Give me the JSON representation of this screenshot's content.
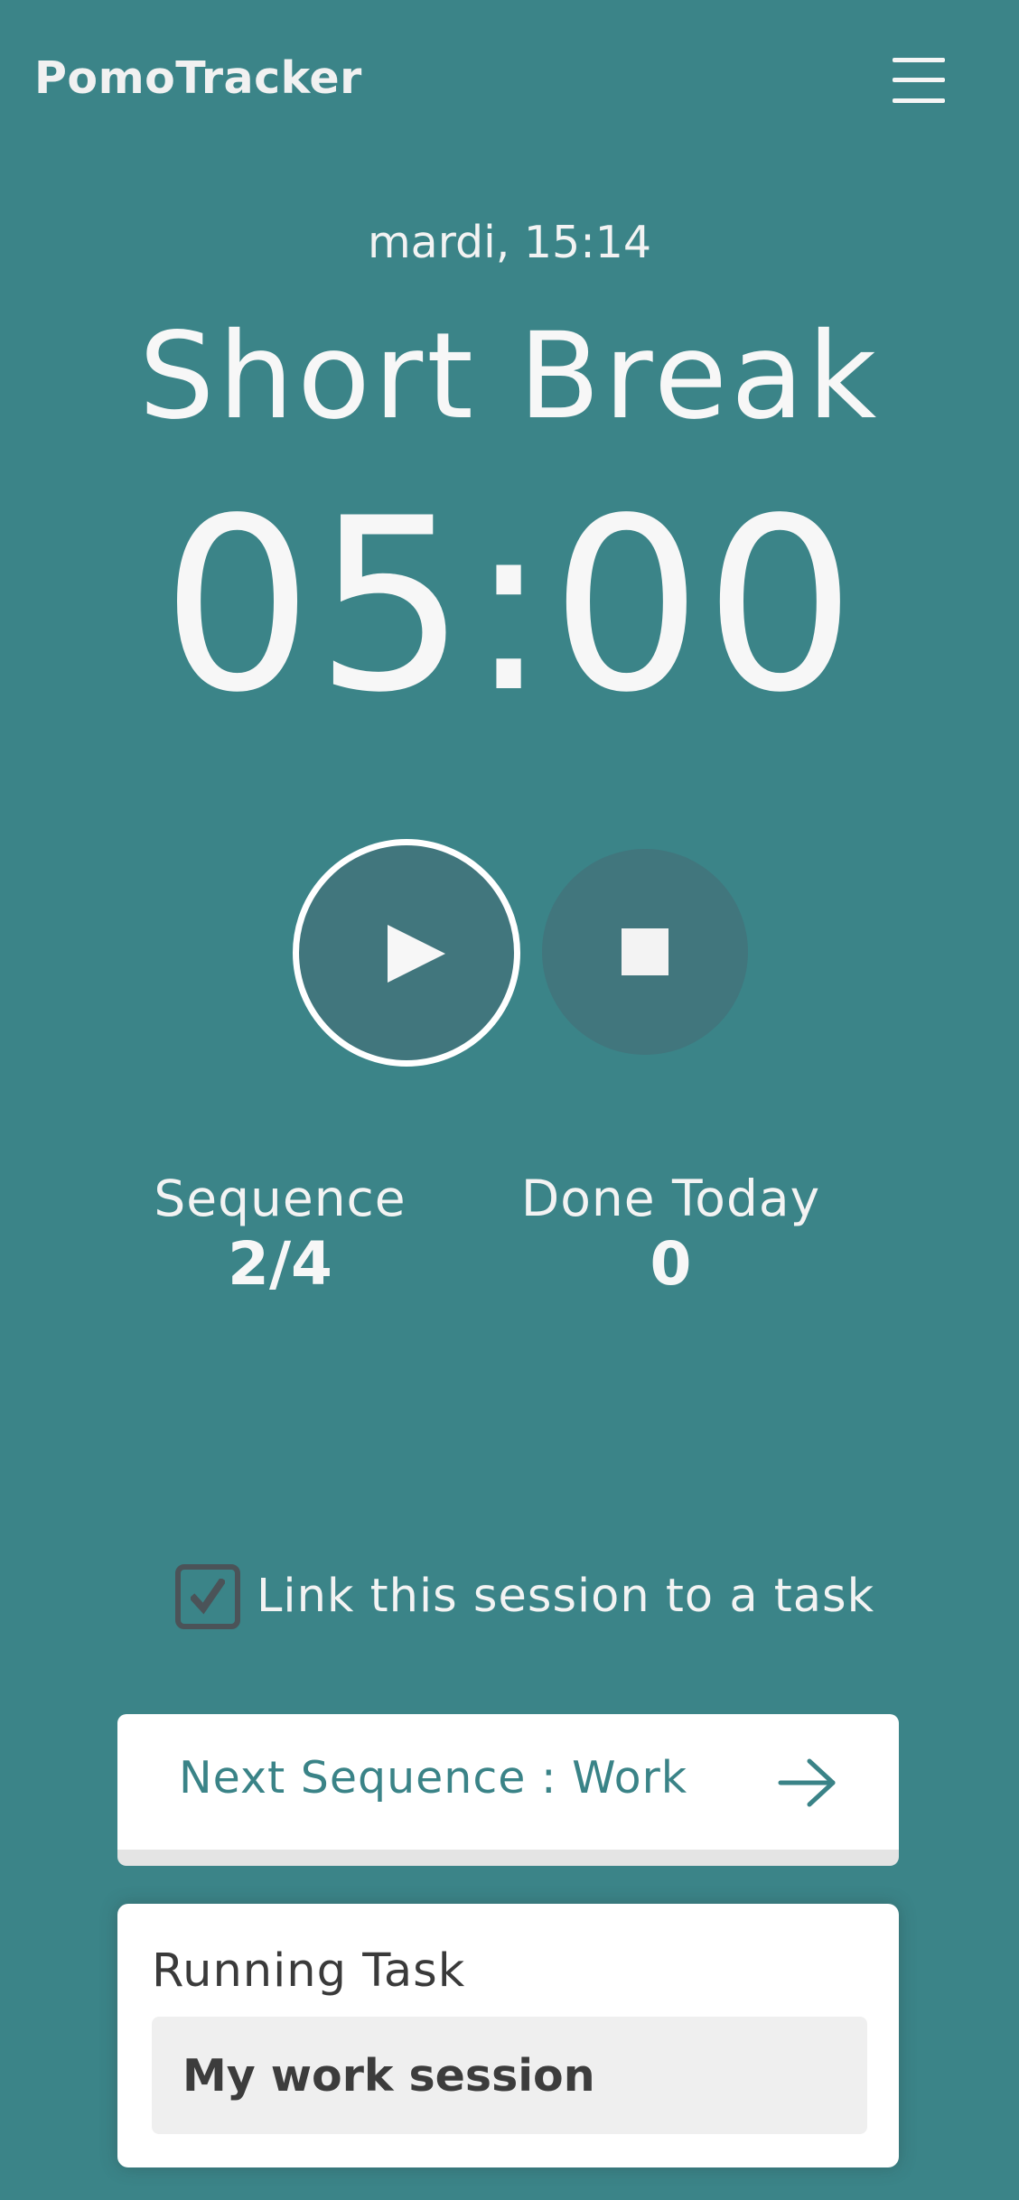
{
  "header": {
    "app_title": "PomoTracker",
    "menu_icon": "hamburger-menu-icon"
  },
  "clock": {
    "datetime": "mardi, 15:14"
  },
  "session": {
    "type": "Short Break",
    "timer": "05:00"
  },
  "controls": {
    "play_icon": "play-icon",
    "stop_icon": "stop-icon"
  },
  "stats": {
    "sequence_label": "Sequence",
    "sequence_value": "2/4",
    "done_today_label": "Done Today",
    "done_today_value": "0"
  },
  "link_task": {
    "label": "Link this session to a task",
    "checked": true
  },
  "next_sequence": {
    "label": "Next Sequence : Work",
    "icon": "arrow-right-icon"
  },
  "running_task": {
    "title": "Running Task",
    "value": "My work session"
  },
  "colors": {
    "background": "#3b8488",
    "button_fill": "#41767d",
    "accent_text": "#3a8387",
    "card": "#ffffff"
  }
}
